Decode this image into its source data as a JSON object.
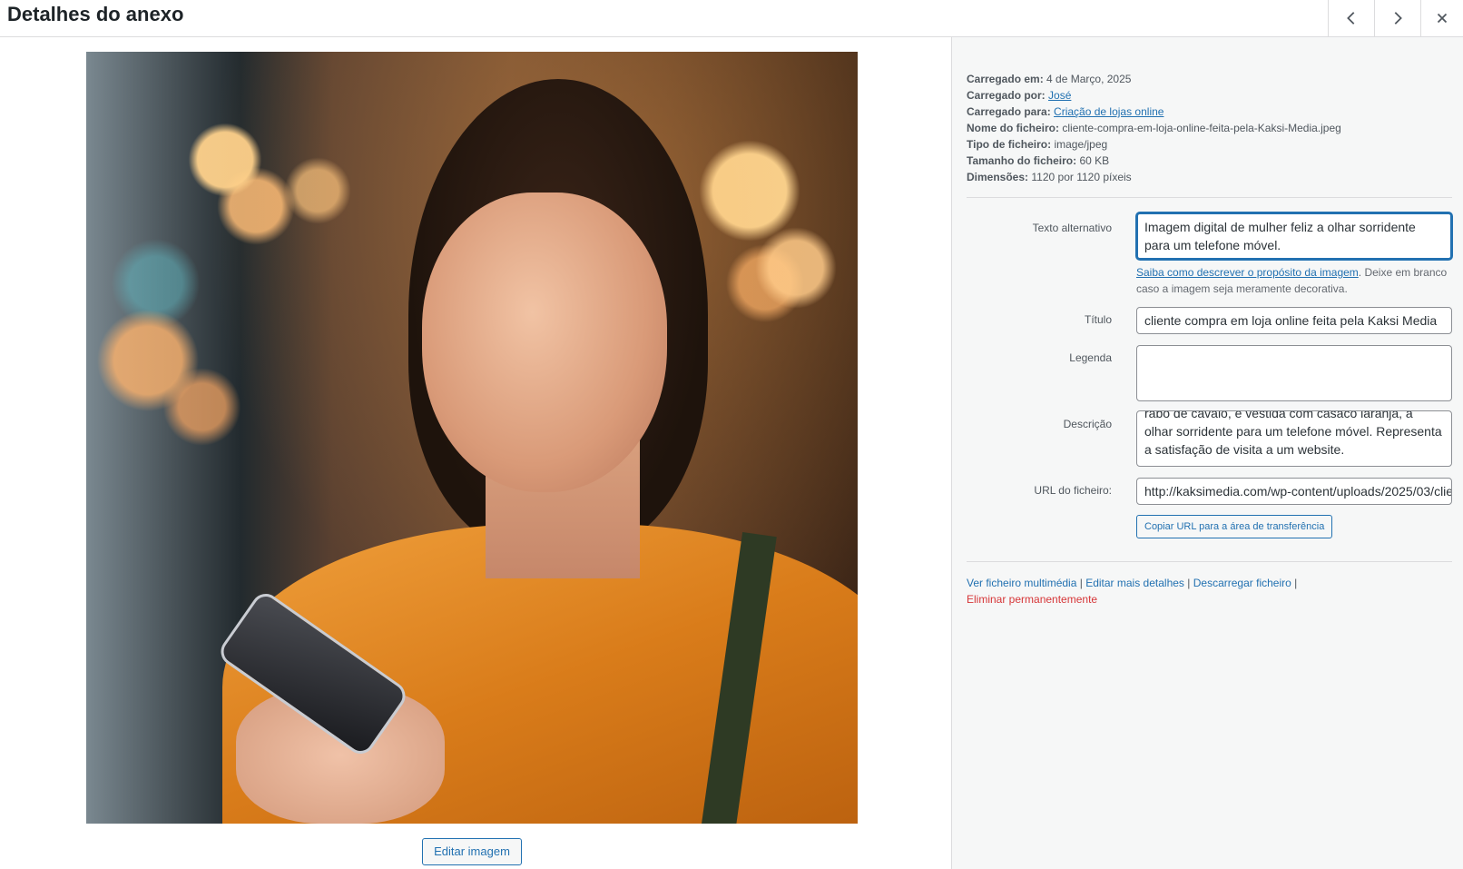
{
  "header": {
    "title": "Detalhes do anexo",
    "prev_icon": "chevron-left-icon",
    "next_icon": "chevron-right-icon",
    "close_icon": "close-icon"
  },
  "media": {
    "edit_button": "Editar imagem"
  },
  "meta": {
    "uploaded_on_label": "Carregado em:",
    "uploaded_on": "4 de Março, 2025",
    "uploaded_by_label": "Carregado por:",
    "uploaded_by": "José",
    "uploaded_to_label": "Carregado para:",
    "uploaded_to": "Criação de lojas online",
    "file_name_label": "Nome do ficheiro:",
    "file_name": "cliente-compra-em-loja-online-feita-pela-Kaksi-Media.jpeg",
    "file_type_label": "Tipo de ficheiro:",
    "file_type": "image/jpeg",
    "file_size_label": "Tamanho do ficheiro:",
    "file_size": "60 KB",
    "dimensions_label": "Dimensões:",
    "dimensions": "1120 por 1120 píxeis"
  },
  "form": {
    "alt_label": "Texto alternativo",
    "alt_value": "Imagem digital de mulher feliz a olhar sorridente para um telefone móvel.",
    "help_link": "Saiba como descrever o propósito da imagem",
    "help_text": ". Deixe em branco caso a imagem seja meramente decorativa.",
    "title_label": "Título",
    "title_value": "cliente compra em loja online feita pela Kaksi Media",
    "caption_label": "Legenda",
    "caption_value": "",
    "description_label": "Descrição",
    "description_value": "rabo de cavalo, e vestida com casaco laranja, a olhar sorridente para um telefone móvel. Representa a satisfação de visita a um website.",
    "url_label": "URL do ficheiro:",
    "url_value": "http://kaksimedia.com/wp-content/uploads/2025/03/cliente-compra-em-loja-online-feita-pela-Kaksi-Media.jpeg",
    "copy_button": "Copiar URL para a área de transferência"
  },
  "actions": {
    "view": "Ver ficheiro multimédia",
    "edit_more": "Editar mais detalhes",
    "download": "Descarregar ficheiro",
    "delete": "Eliminar permanentemente",
    "separator": "|"
  }
}
